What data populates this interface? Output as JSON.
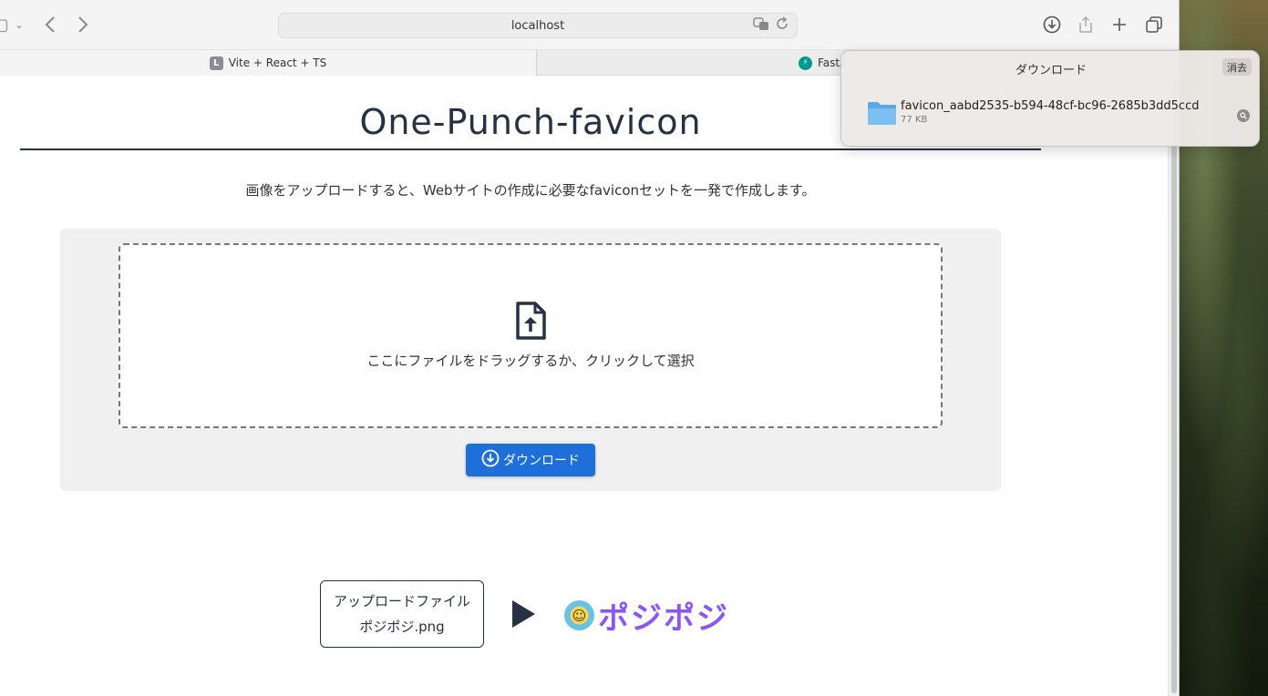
{
  "browser": {
    "address": "localhost",
    "tabs": [
      {
        "favicon_letter": "L",
        "label": "Vite + React + TS"
      },
      {
        "favicon_letter": "⚡",
        "label": "FastA"
      }
    ]
  },
  "page": {
    "title": "One-Punch-favicon",
    "subtitle": "画像をアップロードすると、Webサイトの作成に必要なfaviconセットを一発で作成します。",
    "dropzone_text": "ここにファイルをドラッグするか、クリックして選択",
    "download_label": "ダウンロード",
    "demo": {
      "box_line1": "アップロードファイル",
      "box_line2": "ポジポジ.png",
      "result_text": "ポジポジ",
      "result_smile": "☺"
    }
  },
  "downloads": {
    "title": "ダウンロード",
    "clear_label": "消去",
    "item": {
      "filename": "favicon_aabd2535-b594-48cf-bc96-2685b3dd5ccd",
      "size": "77 KB"
    }
  },
  "colors": {
    "accent": "#1e6fd9",
    "heading": "#263244",
    "result_text": "#8b56f5"
  }
}
